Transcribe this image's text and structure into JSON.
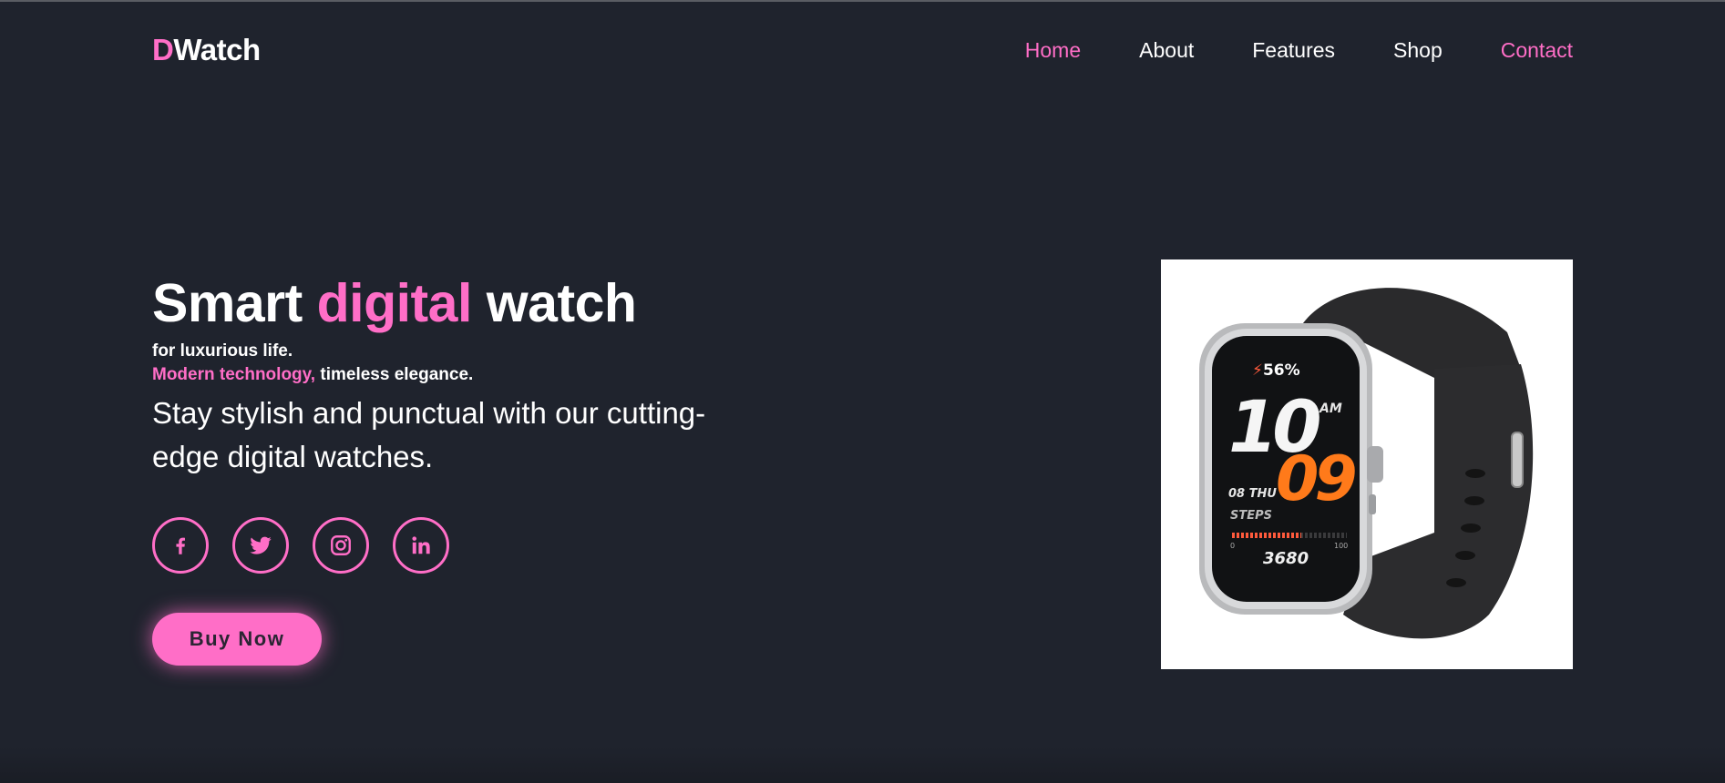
{
  "brand": {
    "first": "D",
    "rest": "Watch"
  },
  "nav": {
    "items": [
      {
        "label": "Home"
      },
      {
        "label": "About"
      },
      {
        "label": "Features"
      },
      {
        "label": "Shop"
      },
      {
        "label": "Contact"
      }
    ]
  },
  "hero": {
    "title_part1": "Smart ",
    "title_accent": "digital",
    "title_part2": " watch",
    "tagline1": "for luxurious life.",
    "tagline2_accent": "Modern technology,",
    "tagline2_rest": " timeless elegance.",
    "description": "Stay stylish and punctual with our cutting-edge digital watches.",
    "buy_label": "Buy Now"
  },
  "socials": [
    {
      "icon": "facebook-icon"
    },
    {
      "icon": "twitter-icon"
    },
    {
      "icon": "instagram-icon"
    },
    {
      "icon": "linkedin-icon"
    }
  ],
  "watch_display": {
    "battery": "56%",
    "hour": "10",
    "ampm": "AM",
    "minute": "09",
    "date": "08 THU",
    "steps_label": "STEPS",
    "steps_min": "0",
    "steps_max": "100",
    "steps": "3680",
    "steps_progress": 0.6
  },
  "colors": {
    "background": "#1f232d",
    "accent": "#ff6ec7",
    "text": "#ffffff"
  }
}
